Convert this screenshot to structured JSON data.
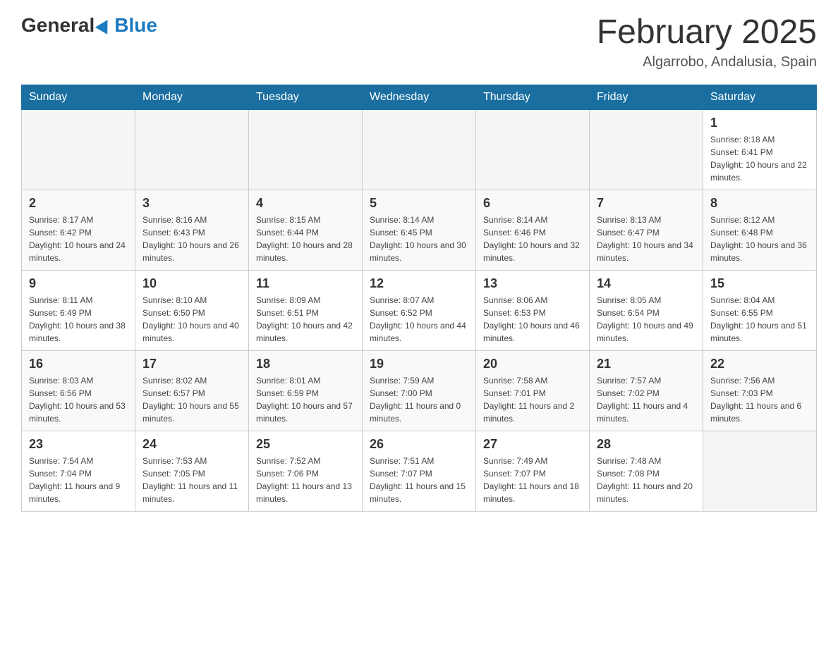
{
  "header": {
    "logo_general": "General",
    "logo_blue": "Blue",
    "month_title": "February 2025",
    "location": "Algarrobo, Andalusia, Spain"
  },
  "days_of_week": [
    "Sunday",
    "Monday",
    "Tuesday",
    "Wednesday",
    "Thursday",
    "Friday",
    "Saturday"
  ],
  "weeks": [
    {
      "days": [
        {
          "number": "",
          "info": ""
        },
        {
          "number": "",
          "info": ""
        },
        {
          "number": "",
          "info": ""
        },
        {
          "number": "",
          "info": ""
        },
        {
          "number": "",
          "info": ""
        },
        {
          "number": "",
          "info": ""
        },
        {
          "number": "1",
          "info": "Sunrise: 8:18 AM\nSunset: 6:41 PM\nDaylight: 10 hours and 22 minutes."
        }
      ]
    },
    {
      "days": [
        {
          "number": "2",
          "info": "Sunrise: 8:17 AM\nSunset: 6:42 PM\nDaylight: 10 hours and 24 minutes."
        },
        {
          "number": "3",
          "info": "Sunrise: 8:16 AM\nSunset: 6:43 PM\nDaylight: 10 hours and 26 minutes."
        },
        {
          "number": "4",
          "info": "Sunrise: 8:15 AM\nSunset: 6:44 PM\nDaylight: 10 hours and 28 minutes."
        },
        {
          "number": "5",
          "info": "Sunrise: 8:14 AM\nSunset: 6:45 PM\nDaylight: 10 hours and 30 minutes."
        },
        {
          "number": "6",
          "info": "Sunrise: 8:14 AM\nSunset: 6:46 PM\nDaylight: 10 hours and 32 minutes."
        },
        {
          "number": "7",
          "info": "Sunrise: 8:13 AM\nSunset: 6:47 PM\nDaylight: 10 hours and 34 minutes."
        },
        {
          "number": "8",
          "info": "Sunrise: 8:12 AM\nSunset: 6:48 PM\nDaylight: 10 hours and 36 minutes."
        }
      ]
    },
    {
      "days": [
        {
          "number": "9",
          "info": "Sunrise: 8:11 AM\nSunset: 6:49 PM\nDaylight: 10 hours and 38 minutes."
        },
        {
          "number": "10",
          "info": "Sunrise: 8:10 AM\nSunset: 6:50 PM\nDaylight: 10 hours and 40 minutes."
        },
        {
          "number": "11",
          "info": "Sunrise: 8:09 AM\nSunset: 6:51 PM\nDaylight: 10 hours and 42 minutes."
        },
        {
          "number": "12",
          "info": "Sunrise: 8:07 AM\nSunset: 6:52 PM\nDaylight: 10 hours and 44 minutes."
        },
        {
          "number": "13",
          "info": "Sunrise: 8:06 AM\nSunset: 6:53 PM\nDaylight: 10 hours and 46 minutes."
        },
        {
          "number": "14",
          "info": "Sunrise: 8:05 AM\nSunset: 6:54 PM\nDaylight: 10 hours and 49 minutes."
        },
        {
          "number": "15",
          "info": "Sunrise: 8:04 AM\nSunset: 6:55 PM\nDaylight: 10 hours and 51 minutes."
        }
      ]
    },
    {
      "days": [
        {
          "number": "16",
          "info": "Sunrise: 8:03 AM\nSunset: 6:56 PM\nDaylight: 10 hours and 53 minutes."
        },
        {
          "number": "17",
          "info": "Sunrise: 8:02 AM\nSunset: 6:57 PM\nDaylight: 10 hours and 55 minutes."
        },
        {
          "number": "18",
          "info": "Sunrise: 8:01 AM\nSunset: 6:59 PM\nDaylight: 10 hours and 57 minutes."
        },
        {
          "number": "19",
          "info": "Sunrise: 7:59 AM\nSunset: 7:00 PM\nDaylight: 11 hours and 0 minutes."
        },
        {
          "number": "20",
          "info": "Sunrise: 7:58 AM\nSunset: 7:01 PM\nDaylight: 11 hours and 2 minutes."
        },
        {
          "number": "21",
          "info": "Sunrise: 7:57 AM\nSunset: 7:02 PM\nDaylight: 11 hours and 4 minutes."
        },
        {
          "number": "22",
          "info": "Sunrise: 7:56 AM\nSunset: 7:03 PM\nDaylight: 11 hours and 6 minutes."
        }
      ]
    },
    {
      "days": [
        {
          "number": "23",
          "info": "Sunrise: 7:54 AM\nSunset: 7:04 PM\nDaylight: 11 hours and 9 minutes."
        },
        {
          "number": "24",
          "info": "Sunrise: 7:53 AM\nSunset: 7:05 PM\nDaylight: 11 hours and 11 minutes."
        },
        {
          "number": "25",
          "info": "Sunrise: 7:52 AM\nSunset: 7:06 PM\nDaylight: 11 hours and 13 minutes."
        },
        {
          "number": "26",
          "info": "Sunrise: 7:51 AM\nSunset: 7:07 PM\nDaylight: 11 hours and 15 minutes."
        },
        {
          "number": "27",
          "info": "Sunrise: 7:49 AM\nSunset: 7:07 PM\nDaylight: 11 hours and 18 minutes."
        },
        {
          "number": "28",
          "info": "Sunrise: 7:48 AM\nSunset: 7:08 PM\nDaylight: 11 hours and 20 minutes."
        },
        {
          "number": "",
          "info": ""
        }
      ]
    }
  ]
}
